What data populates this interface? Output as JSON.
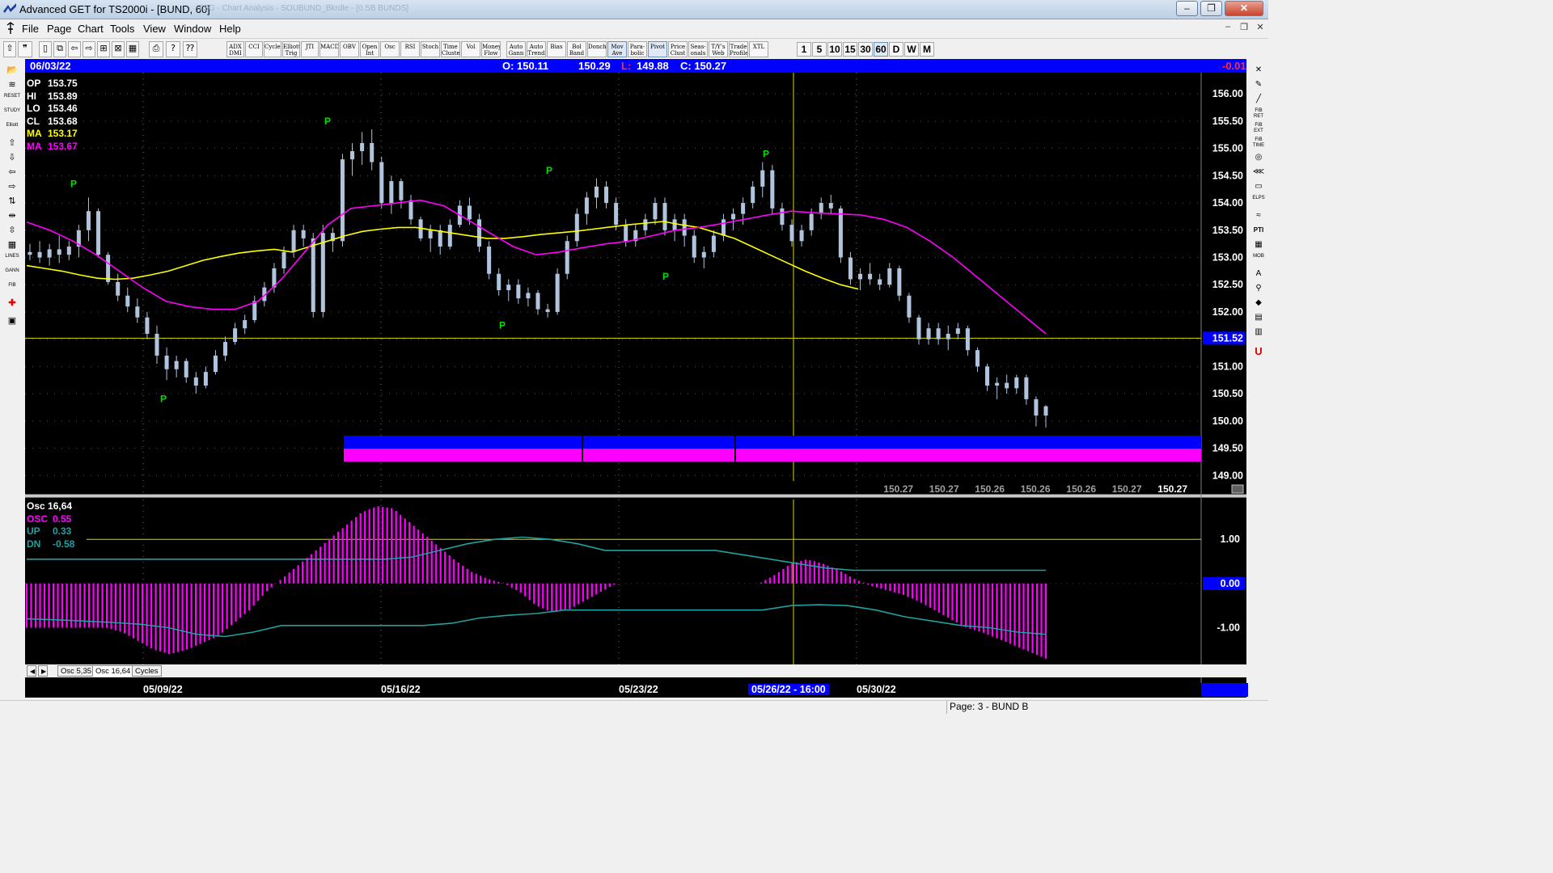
{
  "window": {
    "title": "Advanced GET for TS2000i - [BUND, 60]",
    "ghost_title": "TSG - Chart Analysis - SOUBUND_Bkrdle - [0.SB BUNDS]",
    "buttons": [
      "‒",
      "❐",
      "✕"
    ]
  },
  "menubar": {
    "items": [
      "File",
      "Page",
      "Chart",
      "Tools",
      "View",
      "Window",
      "Help"
    ],
    "mdi_buttons": [
      "‒",
      "❐",
      "✕"
    ]
  },
  "toolbar": {
    "study_buttons": [
      "ADX DMI",
      "CCI",
      "Cycles",
      "Elliott Trig",
      "JTI",
      "MACD",
      "OBV",
      "Open Int",
      "Osc",
      "RSI",
      "Stoch",
      "Time Cluster",
      "Vol",
      "Money Flow",
      "Auto Gann",
      "Auto Trend",
      "Bias",
      "Bol Band",
      "Donch",
      "Mov Ave",
      "Para-bolic",
      "Pivot",
      "Price Clust",
      "Seas-onals",
      "T/Y's Web",
      "Trade Profile",
      "XTL"
    ],
    "timeframes": [
      "1",
      "5",
      "10",
      "15",
      "30",
      "60",
      "D",
      "W",
      "M"
    ],
    "active_timeframe": "60"
  },
  "infobar": {
    "date": "06/03/22",
    "open": "O: 150.11",
    "high": "150.29",
    "low_label": "L:",
    "low": "149.88",
    "close": "C: 150.27",
    "change": "-0.01"
  },
  "price_legend": [
    {
      "label": "OP",
      "value": "153.75",
      "color": "#ffffff"
    },
    {
      "label": "HI",
      "value": "153.89",
      "color": "#ffffff"
    },
    {
      "label": "LO",
      "value": "153.46",
      "color": "#ffffff"
    },
    {
      "label": "CL",
      "value": "153.68",
      "color": "#ffffff"
    },
    {
      "label": "MA",
      "value": "153.17",
      "color": "#ffff00"
    },
    {
      "label": "MA",
      "value": "153.67",
      "color": "#ff00ff"
    }
  ],
  "price_axis": {
    "ticks": [
      "156.00",
      "155.50",
      "155.00",
      "154.50",
      "154.00",
      "153.50",
      "153.00",
      "152.50",
      "152.00",
      "151.50",
      "151.00",
      "150.50",
      "150.00",
      "149.50",
      "149.00"
    ],
    "current_marker": "151.52"
  },
  "bottom_values": [
    "150.27",
    "150.27",
    "150.26",
    "150.26",
    "150.26",
    "150.27",
    "150.27"
  ],
  "osc_legend": [
    {
      "label": "Osc 16,64",
      "value": "",
      "color": "#ffffff"
    },
    {
      "label": "OSC",
      "value": "0.55",
      "color": "#ff00ff"
    },
    {
      "label": "UP",
      "value": "0.33",
      "color": "#20a0a0"
    },
    {
      "label": "DN",
      "value": "-0.58",
      "color": "#20a0a0"
    }
  ],
  "osc_axis": {
    "ticks": [
      "1.00",
      "0.00",
      "-1.00"
    ]
  },
  "pivot_label": "P",
  "tabs": [
    "Osc 5,35",
    "Osc 16,64",
    "Cycles"
  ],
  "active_tab": "Osc 16,64",
  "dates": [
    "05/09/22",
    "05/16/22",
    "05/23/22",
    "05/26/22 - 16:00",
    "05/30/22"
  ],
  "status": {
    "page": "Page: 3 - BUND B"
  },
  "colors": {
    "background": "#000000",
    "candle": "#b0c4de",
    "ma_fast": "#ffff00",
    "ma_slow": "#ff00ff",
    "osc": "#ff00ff",
    "bands": "#20a0a0",
    "infobar": "#0000ff"
  },
  "chart_data": {
    "type": "candlestick",
    "ylim": [
      148.9,
      156.3
    ],
    "crosshair_price": 151.52,
    "candles": [
      [
        153.05,
        153.25,
        152.95,
        153.1
      ],
      [
        153.1,
        153.3,
        152.9,
        153.0
      ],
      [
        153.0,
        153.25,
        152.85,
        153.15
      ],
      [
        153.15,
        153.4,
        152.9,
        153.05
      ],
      [
        153.05,
        153.3,
        152.95,
        153.2
      ],
      [
        153.2,
        153.6,
        153.0,
        153.5
      ],
      [
        153.5,
        154.1,
        153.3,
        153.85
      ],
      [
        153.85,
        153.9,
        153.0,
        153.05
      ],
      [
        153.05,
        153.1,
        152.5,
        152.55
      ],
      [
        152.55,
        152.7,
        152.2,
        152.3
      ],
      [
        152.3,
        152.45,
        152.0,
        152.1
      ],
      [
        152.1,
        152.25,
        151.8,
        151.9
      ],
      [
        151.9,
        152.0,
        151.5,
        151.6
      ],
      [
        151.6,
        151.75,
        151.05,
        151.2
      ],
      [
        151.2,
        151.35,
        150.75,
        150.95
      ],
      [
        150.95,
        151.2,
        150.8,
        151.1
      ],
      [
        151.1,
        151.15,
        150.7,
        150.8
      ],
      [
        150.8,
        150.9,
        150.5,
        150.65
      ],
      [
        150.65,
        151.0,
        150.6,
        150.9
      ],
      [
        150.9,
        151.3,
        150.85,
        151.2
      ],
      [
        151.2,
        151.55,
        151.1,
        151.45
      ],
      [
        151.45,
        151.8,
        151.4,
        151.7
      ],
      [
        151.7,
        151.95,
        151.6,
        151.85
      ],
      [
        151.85,
        152.3,
        151.8,
        152.2
      ],
      [
        152.2,
        152.55,
        152.1,
        152.45
      ],
      [
        152.45,
        152.9,
        152.35,
        152.8
      ],
      [
        152.8,
        153.2,
        152.7,
        153.1
      ],
      [
        153.1,
        153.6,
        153.0,
        153.5
      ],
      [
        153.5,
        153.6,
        153.2,
        153.35
      ],
      [
        153.35,
        153.45,
        151.9,
        152.0
      ],
      [
        152.0,
        153.6,
        151.9,
        153.45
      ],
      [
        153.45,
        153.55,
        153.1,
        153.3
      ],
      [
        153.3,
        154.9,
        153.2,
        154.8
      ],
      [
        154.8,
        155.1,
        154.5,
        154.95
      ],
      [
        154.95,
        155.3,
        154.7,
        155.1
      ],
      [
        155.1,
        155.35,
        154.6,
        154.75
      ],
      [
        154.75,
        154.85,
        153.9,
        154.0
      ],
      [
        154.0,
        154.5,
        153.8,
        154.4
      ],
      [
        154.4,
        154.45,
        153.9,
        154.05
      ],
      [
        154.05,
        154.15,
        153.6,
        153.7
      ],
      [
        153.7,
        153.75,
        153.3,
        153.35
      ],
      [
        153.35,
        153.6,
        153.1,
        153.5
      ],
      [
        153.5,
        153.6,
        153.05,
        153.2
      ],
      [
        153.2,
        153.7,
        153.15,
        153.6
      ],
      [
        153.6,
        154.05,
        153.55,
        153.95
      ],
      [
        153.95,
        154.1,
        153.6,
        153.7
      ],
      [
        153.7,
        153.8,
        153.1,
        153.2
      ],
      [
        153.2,
        153.3,
        152.6,
        152.7
      ],
      [
        152.7,
        152.8,
        152.3,
        152.4
      ],
      [
        152.4,
        152.6,
        152.2,
        152.5
      ],
      [
        152.5,
        152.6,
        152.15,
        152.25
      ],
      [
        152.25,
        152.45,
        152.1,
        152.35
      ],
      [
        152.35,
        152.4,
        151.95,
        152.05
      ],
      [
        152.05,
        152.15,
        151.9,
        152.0
      ],
      [
        152.0,
        152.8,
        151.95,
        152.7
      ],
      [
        152.7,
        153.4,
        152.6,
        153.3
      ],
      [
        153.3,
        153.9,
        153.2,
        153.8
      ],
      [
        153.8,
        154.2,
        153.6,
        154.1
      ],
      [
        154.1,
        154.45,
        153.9,
        154.3
      ],
      [
        154.3,
        154.4,
        153.9,
        154.0
      ],
      [
        154.0,
        154.1,
        153.5,
        153.6
      ],
      [
        153.6,
        153.7,
        153.2,
        153.3
      ],
      [
        153.3,
        153.6,
        153.2,
        153.5
      ],
      [
        153.5,
        153.8,
        153.4,
        153.7
      ],
      [
        153.7,
        154.1,
        153.6,
        154.0
      ],
      [
        154.0,
        154.1,
        153.4,
        153.5
      ],
      [
        153.5,
        153.8,
        153.3,
        153.7
      ],
      [
        153.7,
        153.8,
        153.2,
        153.4
      ],
      [
        153.4,
        153.5,
        152.9,
        153.0
      ],
      [
        153.0,
        153.2,
        152.8,
        153.1
      ],
      [
        153.1,
        153.5,
        153.0,
        153.4
      ],
      [
        153.4,
        153.8,
        153.3,
        153.7
      ],
      [
        153.7,
        153.9,
        153.5,
        153.8
      ],
      [
        153.8,
        154.1,
        153.6,
        154.0
      ],
      [
        154.0,
        154.4,
        153.9,
        154.3
      ],
      [
        154.3,
        154.75,
        154.1,
        154.6
      ],
      [
        154.6,
        154.7,
        153.8,
        153.9
      ],
      [
        153.9,
        154.0,
        153.5,
        153.6
      ],
      [
        153.6,
        153.7,
        153.2,
        153.3
      ],
      [
        153.3,
        153.6,
        153.2,
        153.5
      ],
      [
        153.5,
        153.9,
        153.4,
        153.8
      ],
      [
        153.8,
        154.1,
        153.7,
        154.0
      ],
      [
        154.0,
        154.15,
        153.8,
        153.9
      ],
      [
        153.9,
        153.95,
        152.9,
        153.0
      ],
      [
        153.0,
        153.1,
        152.5,
        152.6
      ],
      [
        152.6,
        152.8,
        152.4,
        152.7
      ],
      [
        152.7,
        152.9,
        152.5,
        152.6
      ],
      [
        152.6,
        152.7,
        152.4,
        152.5
      ],
      [
        152.5,
        152.9,
        152.45,
        152.8
      ],
      [
        152.8,
        152.85,
        152.2,
        152.3
      ],
      [
        152.3,
        152.35,
        151.8,
        151.9
      ],
      [
        151.9,
        151.95,
        151.4,
        151.5
      ],
      [
        151.5,
        151.8,
        151.4,
        151.7
      ],
      [
        151.7,
        151.8,
        151.4,
        151.5
      ],
      [
        151.5,
        151.75,
        151.3,
        151.6
      ],
      [
        151.6,
        151.8,
        151.5,
        151.7
      ],
      [
        151.7,
        151.75,
        151.2,
        151.3
      ],
      [
        151.3,
        151.35,
        150.9,
        151.0
      ],
      [
        151.0,
        151.05,
        150.55,
        150.65
      ],
      [
        150.65,
        150.8,
        150.4,
        150.7
      ],
      [
        150.7,
        150.85,
        150.5,
        150.6
      ],
      [
        150.6,
        150.85,
        150.5,
        150.8
      ],
      [
        150.8,
        150.85,
        150.3,
        150.4
      ],
      [
        150.4,
        150.45,
        149.9,
        150.1
      ],
      [
        150.1,
        150.29,
        149.88,
        150.27
      ]
    ],
    "ma_fast": [
      152.85,
      152.8,
      152.75,
      152.68,
      152.62,
      152.6,
      152.62,
      152.68,
      152.75,
      152.85,
      152.95,
      153.02,
      153.08,
      153.12,
      153.15,
      153.1,
      153.2,
      153.3,
      153.4,
      153.48,
      153.52,
      153.55,
      153.55,
      153.5,
      153.45,
      153.4,
      153.35,
      153.35,
      153.38,
      153.42,
      153.45,
      153.48,
      153.52,
      153.56,
      153.6,
      153.63,
      153.66,
      153.6,
      153.55,
      153.45,
      153.35,
      153.2,
      153.05,
      152.9,
      152.75,
      152.62,
      152.5,
      152.42
    ],
    "ma_slow": [
      153.65,
      153.5,
      153.3,
      153.05,
      152.75,
      152.45,
      152.2,
      152.1,
      152.05,
      152.05,
      152.2,
      152.6,
      153.1,
      153.6,
      153.9,
      153.95,
      154.0,
      154.05,
      153.95,
      153.7,
      153.45,
      153.2,
      153.05,
      153.1,
      153.18,
      153.25,
      153.3,
      153.4,
      153.5,
      153.55,
      153.62,
      153.7,
      153.78,
      153.85,
      153.82,
      153.8,
      153.78,
      153.7,
      153.55,
      153.3,
      153.0,
      152.65,
      152.3,
      151.95,
      151.6
    ],
    "pivots": [
      {
        "type": "high",
        "price": 154.2
      },
      {
        "type": "low",
        "price": 150.55
      },
      {
        "type": "high",
        "price": 155.35
      },
      {
        "type": "high",
        "price": 154.45
      },
      {
        "type": "low",
        "price": 151.9
      },
      {
        "type": "low",
        "price": 152.8
      },
      {
        "type": "high",
        "price": 154.75
      }
    ],
    "oscillator": {
      "ylim": [
        -1.85,
        1.9
      ],
      "reference": 1.0,
      "osc": [
        -1.0,
        -1.0,
        -1.0,
        -1.0,
        -1.0,
        -1.0,
        -1.1,
        -1.3,
        -1.5,
        -1.6,
        -1.5,
        -1.35,
        -1.2,
        -0.9,
        -0.6,
        -0.2,
        0.1,
        0.4,
        0.7,
        1.0,
        1.3,
        1.6,
        1.75,
        1.7,
        1.4,
        1.1,
        0.8,
        0.5,
        0.25,
        0.1,
        0.0,
        -0.2,
        -0.5,
        -0.65,
        -0.6,
        -0.4,
        -0.2,
        0.0,
        0.0,
        0.0,
        0.0,
        0.0,
        0.0,
        0.0,
        0.0,
        0.0,
        0.0,
        0.2,
        0.45,
        0.55,
        0.45,
        0.3,
        0.1,
        -0.05,
        -0.15,
        -0.25,
        -0.4,
        -0.6,
        -0.8,
        -1.0,
        -1.1,
        -1.25,
        -1.4,
        -1.55,
        -1.7
      ],
      "up": [
        0.55,
        0.55,
        0.55,
        0.55,
        0.55,
        0.55,
        0.55,
        0.55,
        0.55,
        0.55,
        0.55,
        0.55,
        0.55,
        0.55,
        0.6,
        0.75,
        0.9,
        1.0,
        1.05,
        1.0,
        0.9,
        0.75,
        0.75,
        0.75,
        0.75,
        0.75,
        0.65,
        0.55,
        0.45,
        0.35,
        0.3,
        0.3,
        0.3,
        0.3,
        0.3,
        0.3,
        0.3,
        0.3
      ],
      "dn": [
        -0.8,
        -0.82,
        -0.85,
        -0.88,
        -0.92,
        -1.0,
        -1.15,
        -1.2,
        -1.1,
        -0.95,
        -0.95,
        -0.95,
        -0.95,
        -0.95,
        -0.95,
        -0.9,
        -0.78,
        -0.72,
        -0.68,
        -0.6,
        -0.6,
        -0.6,
        -0.6,
        -0.6,
        -0.6,
        -0.6,
        -0.6,
        -0.5,
        -0.48,
        -0.5,
        -0.6,
        -0.75,
        -0.85,
        -0.95,
        -1.0,
        -1.1,
        -1.15
      ]
    }
  }
}
